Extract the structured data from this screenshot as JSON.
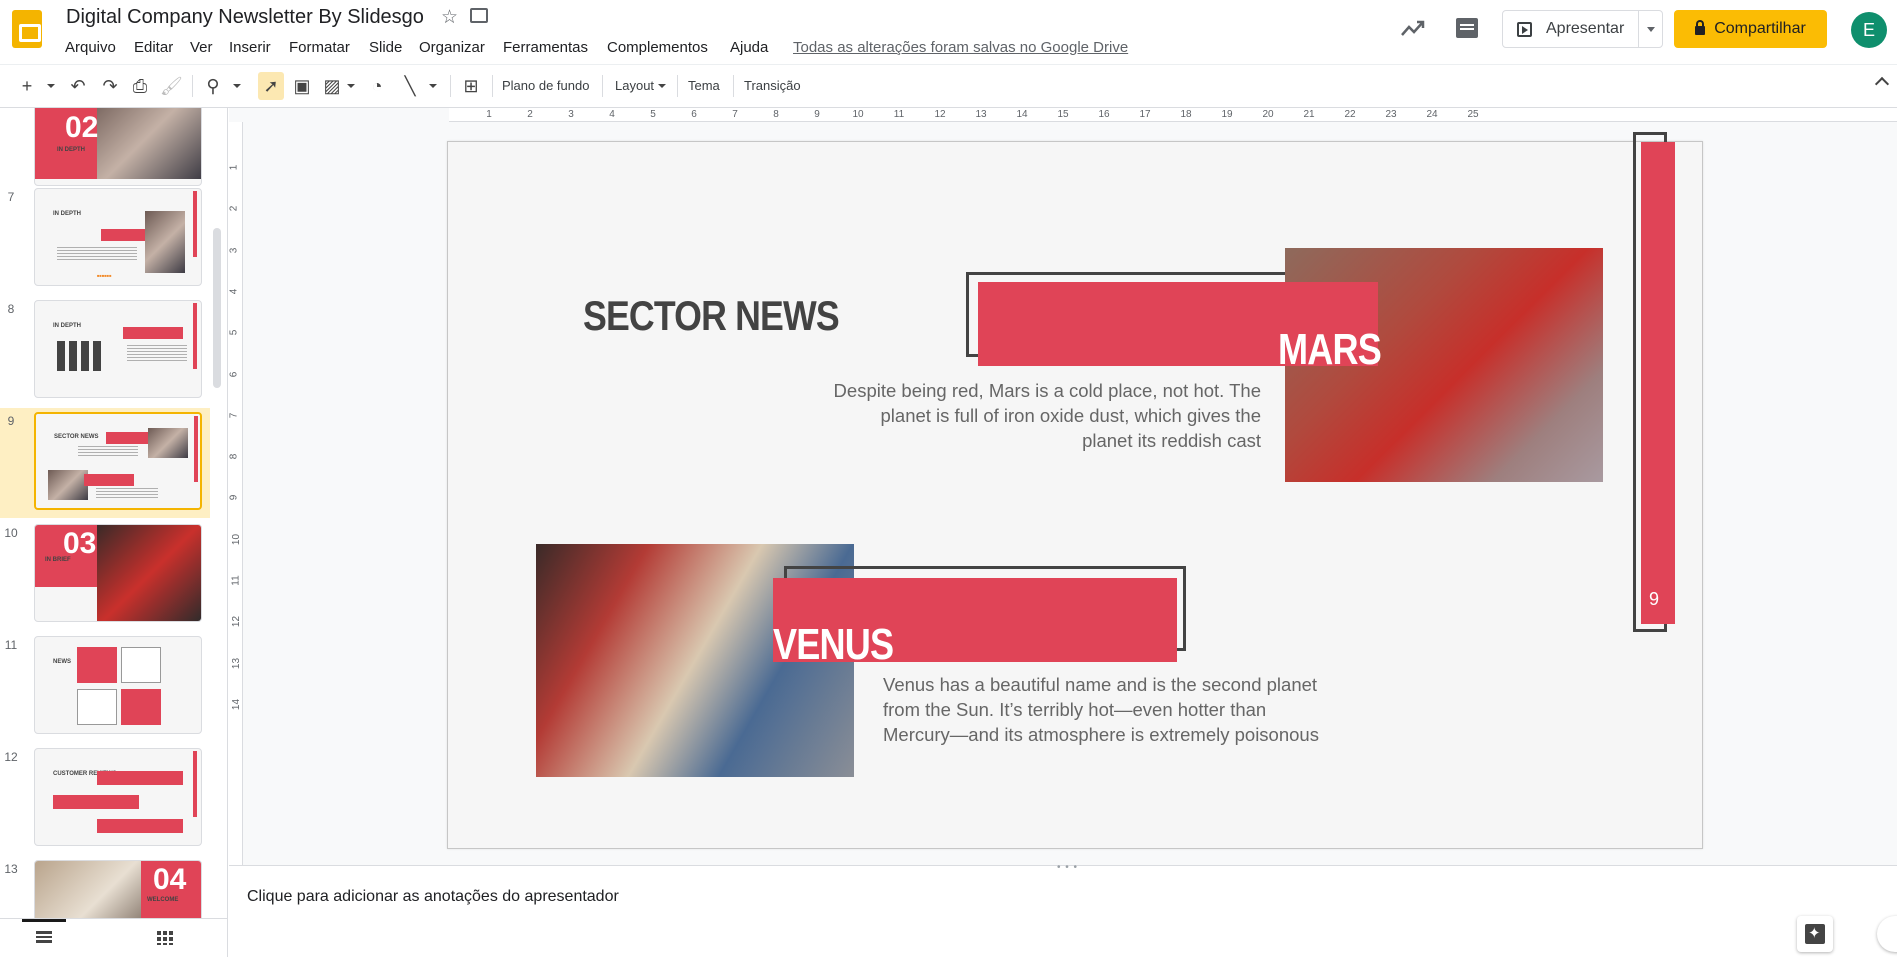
{
  "header": {
    "title": "Digital Company Newsletter By Slidesgo",
    "save_status": "Todas as alterações foram salvas no Google Drive",
    "present_label": "Apresentar",
    "share_label": "Compartilhar",
    "avatar_letter": "E",
    "menu": [
      "Arquivo",
      "Editar",
      "Ver",
      "Inserir",
      "Formatar",
      "Slide",
      "Organizar",
      "Ferramentas",
      "Complementos",
      "Ajuda"
    ],
    "brand_color": "#f4b400",
    "share_color": "#fbbc04",
    "avatar_color": "#0f8f6d"
  },
  "toolbar": {
    "background_label": "Plano de fundo",
    "layout_label": "Layout",
    "theme_label": "Tema",
    "transition_label": "Transição",
    "icons": [
      "add-icon",
      "undo-icon",
      "redo-icon",
      "print-icon",
      "paint-format-icon",
      "zoom-icon",
      "select-icon",
      "textbox-icon",
      "image-icon",
      "shape-icon",
      "line-icon",
      "comment-add-icon"
    ]
  },
  "ruler": {
    "horizontal": [
      "1",
      "2",
      "3",
      "4",
      "5",
      "6",
      "7",
      "8",
      "9",
      "10",
      "11",
      "12",
      "13",
      "14",
      "15",
      "16",
      "17",
      "18",
      "19",
      "20",
      "21",
      "22",
      "23",
      "24",
      "25"
    ],
    "vertical": [
      "1",
      "2",
      "3",
      "4",
      "5",
      "6",
      "7",
      "8",
      "9",
      "10",
      "11",
      "12",
      "13",
      "14"
    ]
  },
  "filmstrip": {
    "slides": [
      {
        "number": "",
        "kind": "numbered",
        "big_number": "02",
        "caption": "IN DEPTH"
      },
      {
        "number": "7",
        "kind": "in-depth-text",
        "caption": "IN DEPTH"
      },
      {
        "number": "8",
        "kind": "in-depth-chart",
        "caption": "IN DEPTH"
      },
      {
        "number": "9",
        "kind": "sector-news",
        "caption": "SECTOR NEWS",
        "active": true
      },
      {
        "number": "10",
        "kind": "numbered",
        "big_number": "03",
        "caption": "IN BRIEF"
      },
      {
        "number": "11",
        "kind": "news-grid",
        "caption": "NEWS"
      },
      {
        "number": "12",
        "kind": "reviews",
        "caption": "CUSTOMER REVIEWS"
      },
      {
        "number": "13",
        "kind": "numbered-photo",
        "big_number": "04",
        "caption": "WELCOME"
      }
    ]
  },
  "slide": {
    "title": "SECTOR NEWS",
    "mars": {
      "heading": "MARS",
      "body": "Despite being red, Mars is a cold place, not hot. The planet is full of iron oxide dust, which gives the planet its reddish cast"
    },
    "venus": {
      "heading": "VENUS",
      "body": "Venus has a beautiful name and is the second planet from the Sun. It’s terribly hot—even hotter than Mercury—and its atmosphere is extremely poisonous"
    },
    "page_number": "9",
    "accent_color": "#e04457",
    "dark_color": "#434343"
  },
  "notes": {
    "placeholder": "Clique para adicionar as anotações do apresentador"
  }
}
